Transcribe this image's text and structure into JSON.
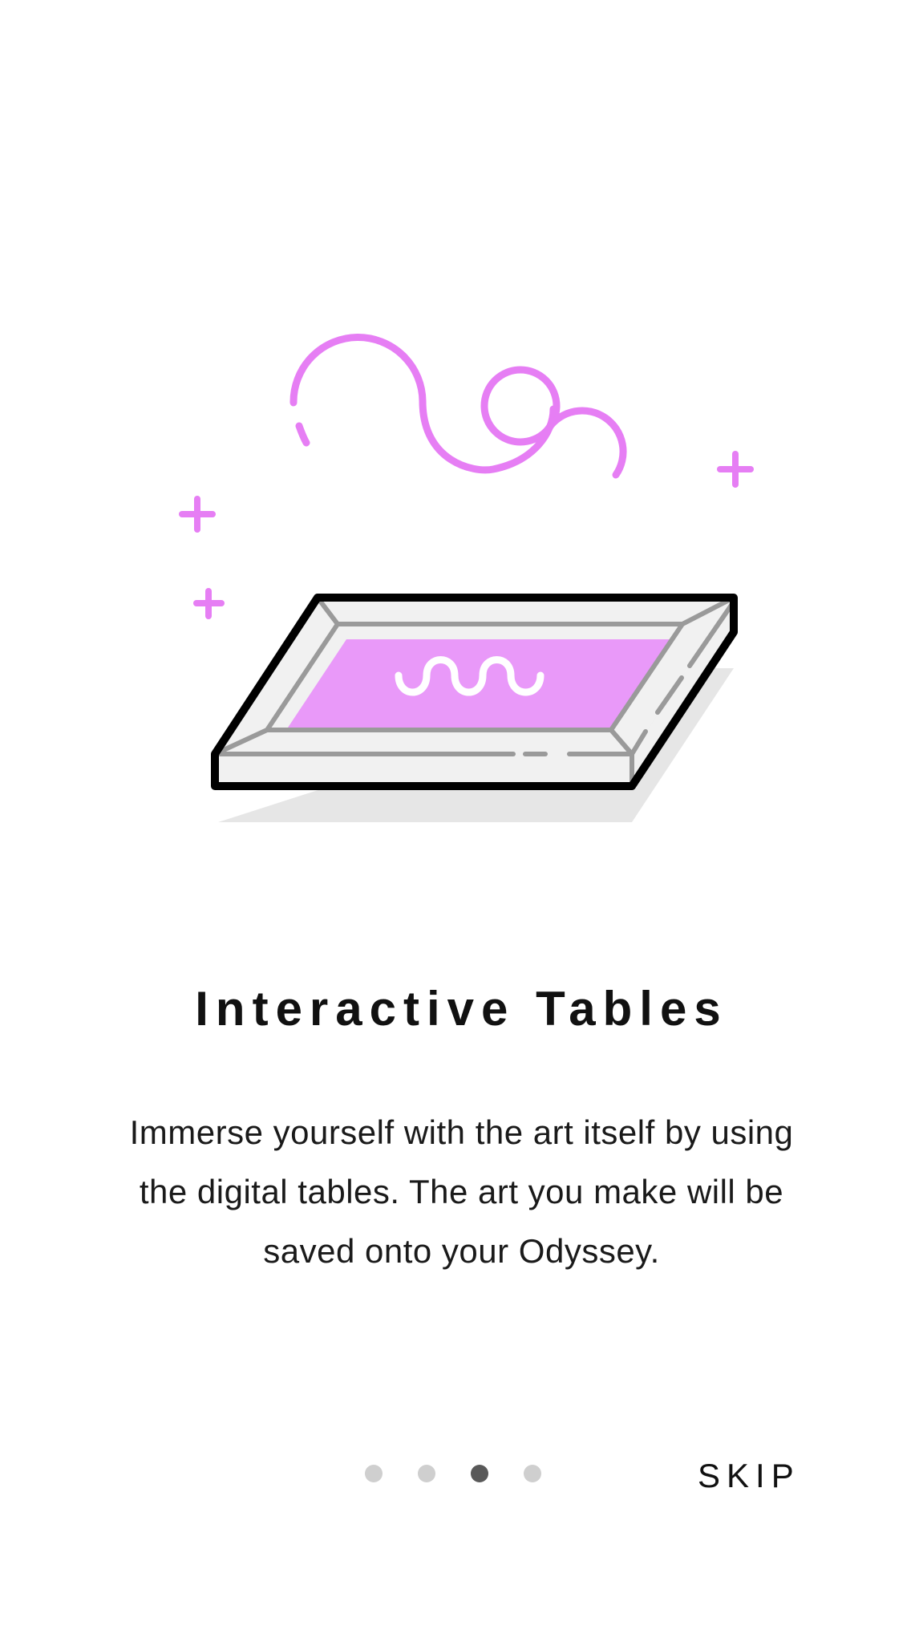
{
  "onboarding": {
    "title": "Interactive Tables",
    "description": "Immerse yourself with the art itself by using the digital tables. The art you make will be saved onto your Odyssey.",
    "illustration_icon": "interactive-table-icon",
    "skip_label": "SKIP",
    "pager": {
      "total_pages": 4,
      "current_page": 3
    }
  },
  "colors": {
    "accent_pink": "#e98ff9",
    "swirl_pink": "#e67ef4",
    "frame_gray": "#f1f1f1",
    "shadow_gray": "#e6e6e6",
    "dot_inactive": "#cfcfcf",
    "dot_active": "#595959"
  }
}
